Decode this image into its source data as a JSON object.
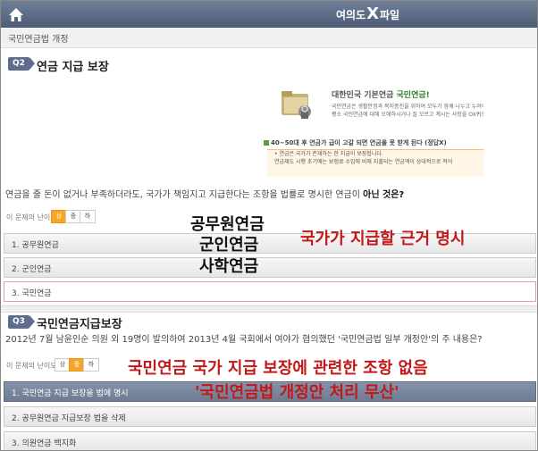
{
  "header": {
    "brand_left": "여의도",
    "brand_x": "X",
    "brand_right": "파일",
    "breadcrumb": "국민연금법 개정"
  },
  "q2": {
    "badge": "Q2",
    "title": "연금 지급 보장",
    "banner": {
      "title_prefix": "대한민국 기본연금",
      "title_emph": "국민연금!",
      "text_line1": "국민연금은 생활안정과 복지증진을 위하여 모두가 함께 나누고 누려야",
      "text_line2": "평소 국민연금에 대해 오해하시거나 잘 모르고 계시는 사항을 OX퀴즈",
      "sub": "40~50대 후 연금가 급이 고갈 되면 연금을 못 받게 된다 (정답X)",
      "box_line1": "• 연금은 국가가 존재하는 한 지급이 보장됩니다.",
      "box_line2": "연금제도 시행 초기에는 보험료 수입에 비해 지출되는 연금액이 상대적으로 적어"
    },
    "question_prefix": "연금을 줄 돈이 없거나 부족하더라도, 국가가 책임지고 지급한다는 조항을 법률로 명시한 연금이",
    "question_emph": "아닌 것은?",
    "difficulty_label": "이 문제의 난이도",
    "difficulty_levels": [
      "상",
      "중",
      "하"
    ],
    "options": [
      "1. 공무원연금",
      "2. 군인연금",
      "3. 국민연금"
    ]
  },
  "q3": {
    "badge": "Q3",
    "title": "국민연금지급보장",
    "question": "2012년 7월 남윤인순 의원 외 19명이 발의하여 2013년 4월 국회에서 여야가 협의했던 '국민연금법 일부 개정안'의 주 내용은?",
    "difficulty_label": "이 문제의 난이도",
    "difficulty_levels": [
      "상",
      "중",
      "하"
    ],
    "options": [
      "1. 국민연금 지급 보장을 법에 명시",
      "2. 공무원연금 지급보장 법을 삭제",
      "3. 의원연금 백지화"
    ]
  },
  "overlay": {
    "pensions": [
      "공무원연금",
      "군인연금",
      "사학연금"
    ],
    "state_basis": "국가가 지급할 근거 명시",
    "no_clause": "국민연금 국가 지급 보장에 관련한 조항 없음",
    "scrapped": "'국민연금법 개정안 처리 무산'"
  }
}
